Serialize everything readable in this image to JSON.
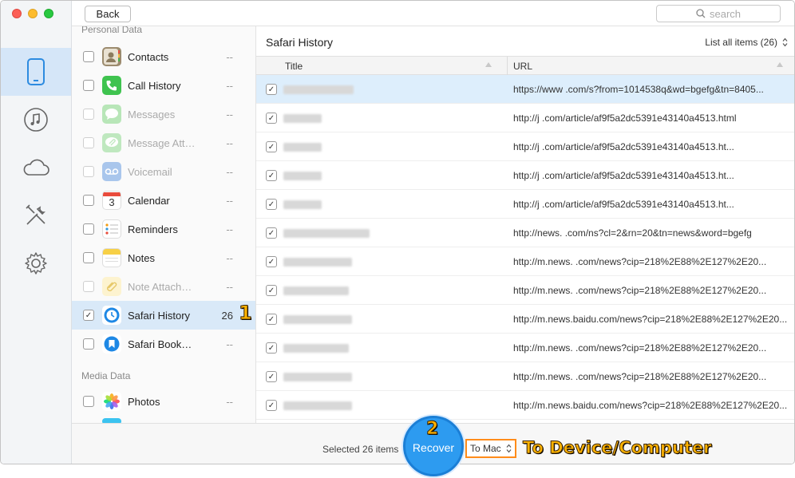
{
  "toolbar": {
    "back_label": "Back",
    "search_placeholder": "search"
  },
  "sections": {
    "personal": "Personal Data",
    "media": "Media Data"
  },
  "categories": [
    {
      "label": "Contacts",
      "count": "--",
      "disabled": false
    },
    {
      "label": "Call History",
      "count": "--",
      "disabled": false
    },
    {
      "label": "Messages",
      "count": "--",
      "disabled": true
    },
    {
      "label": "Message Att…",
      "count": "--",
      "disabled": true
    },
    {
      "label": "Voicemail",
      "count": "--",
      "disabled": true
    },
    {
      "label": "Calendar",
      "count": "--",
      "disabled": false
    },
    {
      "label": "Reminders",
      "count": "--",
      "disabled": false
    },
    {
      "label": "Notes",
      "count": "--",
      "disabled": false
    },
    {
      "label": "Note Attach…",
      "count": "--",
      "disabled": true
    },
    {
      "label": "Safari History",
      "count": "26",
      "disabled": false,
      "selected": true
    },
    {
      "label": "Safari Book…",
      "count": "--",
      "disabled": false
    },
    {
      "label": "Photos",
      "count": "--",
      "disabled": false
    }
  ],
  "calendar_day": "3",
  "content": {
    "title": "Safari History",
    "list_filter": "List all items (26)",
    "columns": {
      "title": "Title",
      "url": "URL"
    },
    "rows": [
      {
        "url": "https://www         .com/s?from=1014538q&wd=bgefg&tn=8405..."
      },
      {
        "url": "http://j         .com/article/af9f5a2dc5391e43140a4513.html"
      },
      {
        "url": "http://j         .com/article/af9f5a2dc5391e43140a4513.ht..."
      },
      {
        "url": "http://j         .com/article/af9f5a2dc5391e43140a4513.ht..."
      },
      {
        "url": "http://j         .com/article/af9f5a2dc5391e43140a4513.ht..."
      },
      {
        "url": "http://news.        .com/ns?cl=2&rn=20&tn=news&word=bgefg"
      },
      {
        "url": "http://m.news.        .com/news?cip=218%2E88%2E127%2E20..."
      },
      {
        "url": "http://m.news.        .com/news?cip=218%2E88%2E127%2E20..."
      },
      {
        "url": "http://m.news.baidu.com/news?cip=218%2E88%2E127%2E20..."
      },
      {
        "url": "http://m.news.        .com/news?cip=218%2E88%2E127%2E20..."
      },
      {
        "url": "http://m.news.        .com/news?cip=218%2E88%2E127%2E20..."
      },
      {
        "url": "http://m.news.baidu.com/news?cip=218%2E88%2E127%2E20..."
      }
    ]
  },
  "footer": {
    "selected": "Selected 26 items",
    "recover_label": "Recover",
    "destination": "To Mac"
  },
  "annotations": {
    "step1": "1",
    "step2": "2",
    "callout": "To Device/Computer"
  },
  "colors": {
    "accent": "#2d9bf0",
    "selection": "#d9e9f8",
    "annotation": "#ffb300",
    "highlight_border": "#ff8c1a"
  }
}
